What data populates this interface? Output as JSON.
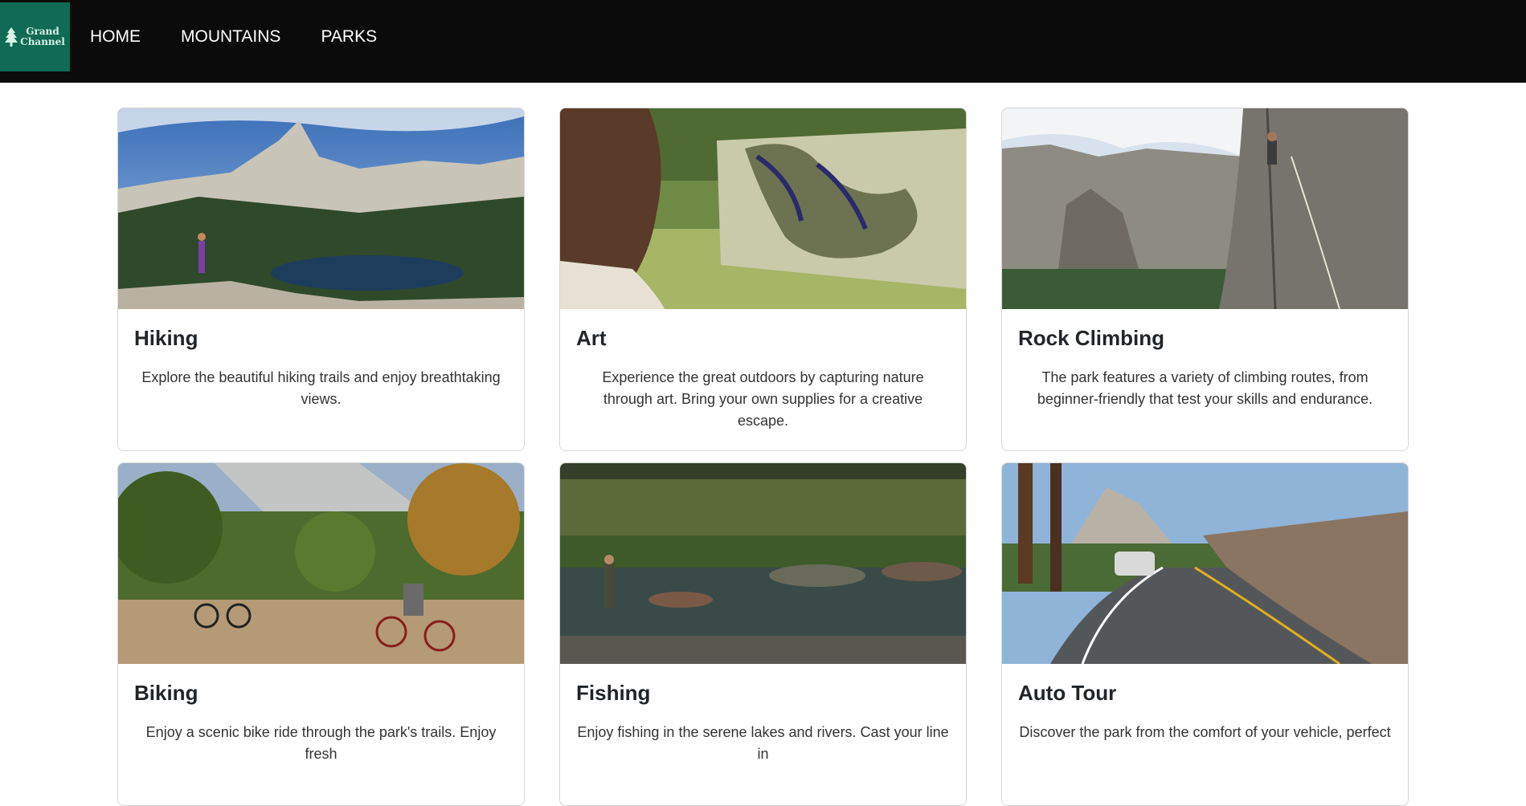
{
  "brand": {
    "line1": "Grand",
    "line2": "Channel",
    "icon": "pine-tree-icon"
  },
  "nav": {
    "items": [
      {
        "label": "HOME"
      },
      {
        "label": "MOUNTAINS"
      },
      {
        "label": "PARKS"
      }
    ]
  },
  "activities": [
    {
      "title": "Hiking",
      "description": "Explore the beautiful hiking trails and enjoy breathtaking views.",
      "image": "mountain-lake-hiker-photo"
    },
    {
      "title": "Art",
      "description": "Experience the great outdoors by capturing nature through art. Bring your own supplies for a creative escape.",
      "image": "painter-at-easel-photo"
    },
    {
      "title": "Rock Climbing",
      "description": "The park features a variety of climbing routes, from beginner-friendly that test your skills and endurance.",
      "image": "climber-on-cliff-photo"
    },
    {
      "title": "Biking",
      "description": "Enjoy a scenic bike ride through the park's trails. Enjoy fresh",
      "image": "cyclists-on-path-photo"
    },
    {
      "title": "Fishing",
      "description": "Enjoy fishing in the serene lakes and rivers. Cast your line in",
      "image": "angler-in-river-photo"
    },
    {
      "title": "Auto Tour",
      "description": "Discover the park from the comfort of your vehicle, perfect",
      "image": "car-on-mountain-road-photo"
    }
  ],
  "colors": {
    "navbar": "#0b0b0b",
    "logo_bg": "#0f6b53",
    "nav_text": "#ffffff",
    "card_border": "#d7d7d7"
  }
}
